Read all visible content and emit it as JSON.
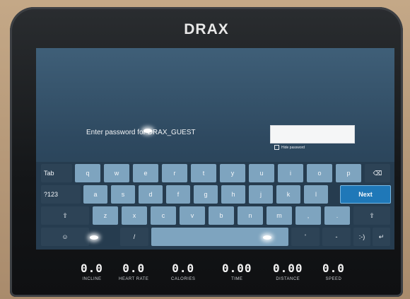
{
  "brand": "DRAX",
  "login": {
    "prompt": "Enter password for DRAX_GUEST",
    "password_value": "",
    "hide_password_label": "Hide password"
  },
  "keyboard": {
    "row1": [
      "Tab",
      "q",
      "w",
      "e",
      "r",
      "t",
      "y",
      "u",
      "i",
      "o",
      "p",
      "⌫"
    ],
    "row2": [
      "?123",
      "a",
      "s",
      "d",
      "f",
      "g",
      "h",
      "j",
      "k",
      "l",
      "Next"
    ],
    "row3": [
      "⇧",
      "z",
      "x",
      "c",
      "v",
      "b",
      "n",
      "m",
      ",",
      ".",
      "⇧"
    ],
    "row4": [
      "☺",
      "/",
      "",
      "'",
      "-",
      ":-)",
      "↵"
    ]
  },
  "stats": [
    {
      "value": "0.0",
      "label": "INCLINE"
    },
    {
      "value": "0.0",
      "label": "HEART RATE"
    },
    {
      "value": "0.0",
      "label": "CALORIES"
    },
    {
      "value": "0.00",
      "label": "TIME"
    },
    {
      "value": "0.00",
      "label": "DISTANCE"
    },
    {
      "value": "0.0",
      "label": "SPEED"
    }
  ],
  "colors": {
    "screen": "#2e4960",
    "key": "#7ea4bf",
    "next_key": "#1f78b8"
  }
}
